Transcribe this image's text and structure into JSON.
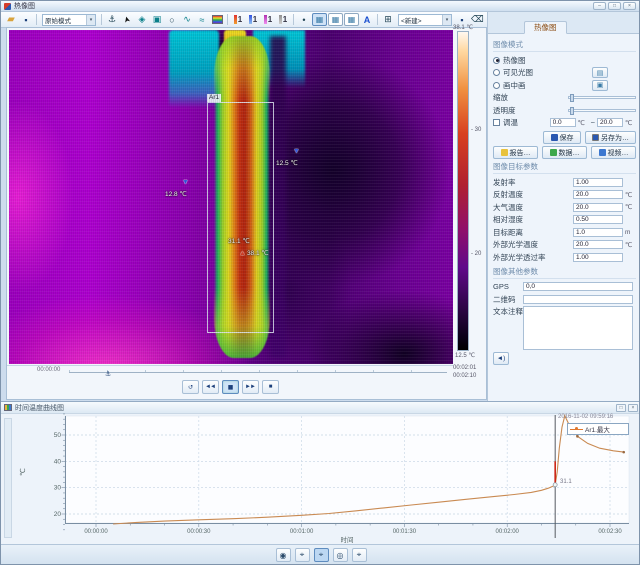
{
  "window": {
    "title": "热像图",
    "controls": [
      "–",
      "□",
      "×"
    ]
  },
  "toolbar": {
    "items": [
      {
        "name": "open-folder-icon",
        "glyph": "▰",
        "cls": "folder"
      },
      {
        "name": "save-file-icon",
        "glyph": "▪",
        "cls": "disk"
      },
      {
        "kind": "sep"
      },
      {
        "kind": "select",
        "name": "display-mode-select",
        "value": "原始模式"
      },
      {
        "kind": "sep"
      },
      {
        "name": "anchor-icon",
        "glyph": "⚓"
      },
      {
        "name": "cursor-tool-icon",
        "glyph": "➤",
        "cls": "cursor"
      },
      {
        "name": "move-tool-icon",
        "glyph": "◈",
        "cls": "teal"
      },
      {
        "name": "area-tool-icon",
        "glyph": "▣",
        "cls": "teal"
      },
      {
        "name": "ellipse-tool-icon",
        "glyph": "○"
      },
      {
        "name": "curve-tool-icon",
        "glyph": "∿",
        "cls": "teal"
      },
      {
        "name": "polyline-tool-icon",
        "glyph": "≈",
        "cls": "teal"
      },
      {
        "name": "palette-icon",
        "cls": "pal"
      },
      {
        "kind": "sep"
      },
      {
        "name": "isotherm-above-icon",
        "glyph": "1",
        "cls": "iso iso-red"
      },
      {
        "name": "isotherm-below-icon",
        "glyph": "1",
        "cls": "iso iso-blue"
      },
      {
        "name": "isotherm-interval-icon",
        "glyph": "1",
        "cls": "iso iso-purple"
      },
      {
        "name": "isotherm-off-icon",
        "glyph": "1",
        "cls": "iso iso-gray"
      },
      {
        "kind": "sep"
      },
      {
        "name": "spot-marker-icon",
        "glyph": "•"
      },
      {
        "name": "thermal-view-icon",
        "glyph": "▦",
        "cls": "framed active"
      },
      {
        "name": "visible-view-icon",
        "glyph": "▦",
        "cls": "framed"
      },
      {
        "name": "gallery-view-icon",
        "glyph": "▦",
        "cls": "framed"
      },
      {
        "name": "text-annotation-icon",
        "glyph": "A",
        "cls": "blue-a"
      },
      {
        "kind": "sep"
      },
      {
        "name": "grid-view-icon",
        "glyph": "⊞"
      },
      {
        "kind": "select",
        "name": "palette-select",
        "value": "<新建>"
      },
      {
        "name": "save-result-icon",
        "glyph": "▪",
        "cls": "disk"
      },
      {
        "name": "eraser-icon",
        "glyph": "⌫"
      },
      {
        "name": "delete-icon",
        "glyph": "⌧"
      }
    ]
  },
  "right_panel": {
    "tab": "热像图",
    "mode_group": {
      "title": "图像模式",
      "radios": [
        {
          "label": "热像图",
          "checked": true
        },
        {
          "label": "可见光图",
          "checked": false,
          "button_glyph": "▤"
        },
        {
          "label": "画中画",
          "checked": false,
          "button_glyph": "▣"
        }
      ],
      "sliders": [
        {
          "label": "缩放"
        },
        {
          "label": "透明度"
        }
      ],
      "range": {
        "checkbox": "调温",
        "min": "0.0",
        "min_unit": "℃",
        "tilde": "~",
        "max": "20.0",
        "max_unit": "℃"
      },
      "save_button": "保存",
      "saveas_button": "另存为…",
      "report_button": "报告…",
      "data_button": "数据…",
      "video_button": "视频…"
    },
    "target_group": {
      "title": "图像目标参数",
      "rows": [
        {
          "label": "发射率",
          "value": "1.00",
          "unit": ""
        },
        {
          "label": "反射温度",
          "value": "20.0",
          "unit": "℃"
        },
        {
          "label": "大气温度",
          "value": "20.0",
          "unit": "℃"
        },
        {
          "label": "相对湿度",
          "value": "0.50",
          "unit": ""
        },
        {
          "label": "目标距离",
          "value": "1.0",
          "unit": "m"
        },
        {
          "label": "外部光学温度",
          "value": "20.0",
          "unit": "℃"
        },
        {
          "label": "外部光学透过率",
          "value": "1.00",
          "unit": ""
        }
      ]
    },
    "other_group": {
      "title": "图像其他参数",
      "gps_label": "GPS",
      "gps_value": "0,0",
      "qr_label": "二维码",
      "qr_value": "",
      "note_label": "文本注释",
      "note_value": "",
      "speaker_glyph": "◄)"
    }
  },
  "thermal": {
    "area_label": "Ar1",
    "marker_left": "12.8 ℃",
    "marker_right": "12.5 ℃",
    "marker_center": "31.1 ℃",
    "marker_max": "38.1 ℃",
    "triangle_down": "▼",
    "triangle_up": "▲",
    "scale": {
      "top": "38.1 ℃",
      "tick_30": "- 30",
      "tick_20": "- 20",
      "bottom": "12.5 ℃"
    },
    "timeline": {
      "start": "00:00:00",
      "current": "00:02:01",
      "total": "00:02:10",
      "anchor_glyph": "⚓"
    }
  },
  "transport": {
    "buttons": [
      {
        "name": "replay-button",
        "glyph": "↺"
      },
      {
        "name": "step-back-button",
        "glyph": "◄◄"
      },
      {
        "name": "pause-button",
        "glyph": "▮▮",
        "pressed": true
      },
      {
        "name": "step-forward-button",
        "glyph": "►►"
      },
      {
        "name": "stop-button",
        "glyph": "■"
      }
    ]
  },
  "chart_panel": {
    "title": "时间温度曲线图",
    "legend": "Ar1.最大",
    "cursor_time_label": "2016-11-02 09:59:16",
    "cursor_value_label": "31.1",
    "controls": [
      "□",
      "×"
    ]
  },
  "chart_data": {
    "type": "line",
    "title": "时间温度曲线图",
    "xlabel": "时间",
    "ylabel": "℃",
    "x_ticks": [
      "00:00:00",
      "00:00:30",
      "00:01:00",
      "00:01:30",
      "00:02:00",
      "00:02:30"
    ],
    "y_ticks": [
      20,
      30,
      40,
      50
    ],
    "ylim": [
      12,
      60
    ],
    "xlim_seconds": [
      0,
      156
    ],
    "grid": true,
    "legend_position": "top-right",
    "series": [
      {
        "name": "Ar1.最大",
        "color": "#c98a52",
        "points": [
          [
            5,
            16.2
          ],
          [
            12,
            16.8
          ],
          [
            20,
            17.3
          ],
          [
            30,
            17.8
          ],
          [
            40,
            18.2
          ],
          [
            50,
            18.8
          ],
          [
            60,
            19.5
          ],
          [
            68,
            20.2
          ],
          [
            76,
            21.2
          ],
          [
            84,
            22.3
          ],
          [
            92,
            23.4
          ],
          [
            100,
            24.5
          ],
          [
            108,
            25.6
          ],
          [
            116,
            26.6
          ],
          [
            122,
            27.4
          ],
          [
            127,
            28.2
          ],
          [
            130,
            29.0
          ],
          [
            132,
            29.8
          ],
          [
            133.4,
            30.6
          ],
          [
            134,
            31.1
          ],
          [
            134.6,
            36.0
          ],
          [
            135.2,
            45.0
          ],
          [
            136.0,
            53.0
          ],
          [
            136.8,
            57.3
          ],
          [
            138.2,
            53.5
          ],
          [
            140.5,
            49.5
          ],
          [
            143.5,
            46.8
          ],
          [
            147,
            45.0
          ],
          [
            151,
            44.0
          ],
          [
            154,
            43.5
          ]
        ],
        "dots": [
          [
            140.5,
            49.5
          ],
          [
            154,
            43.5
          ]
        ]
      }
    ],
    "cursor": {
      "t_seconds": 134,
      "value": 31.1,
      "datetime": "2016-11-02 09:59:16"
    }
  },
  "bottom_toolbar": {
    "buttons": [
      {
        "name": "show-curve-button",
        "glyph": "◉"
      },
      {
        "name": "add-cursor-button",
        "glyph": "⌖"
      },
      {
        "name": "cursor-mode-button",
        "glyph": "⌖",
        "pressed": true
      },
      {
        "name": "show-points-button",
        "glyph": "◎"
      },
      {
        "name": "range-cursor-button",
        "glyph": "⌖"
      }
    ]
  }
}
